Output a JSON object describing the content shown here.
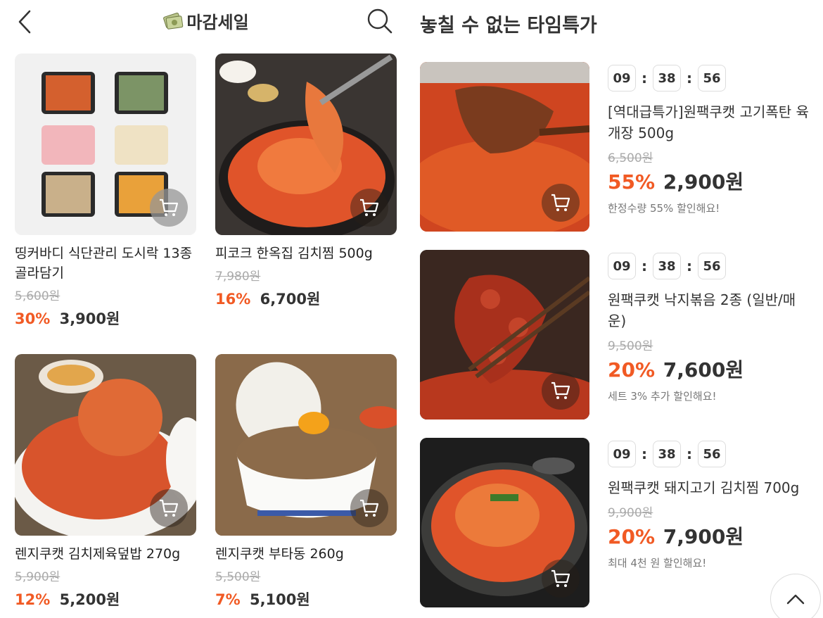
{
  "left": {
    "title": "마감세일",
    "products": [
      {
        "name": "띵커바디 식단관리 도시락 13종 골라담기",
        "original_price": "5,600원",
        "discount": "30%",
        "price": "3,900원"
      },
      {
        "name": "피코크 한옥집 김치찜 500g",
        "original_price": "7,980원",
        "discount": "16%",
        "price": "6,700원"
      },
      {
        "name": "렌지쿠캣 김치제육덮밥 270g",
        "original_price": "5,900원",
        "discount": "12%",
        "price": "5,200원"
      },
      {
        "name": "렌지쿠캣 부타동 260g",
        "original_price": "5,500원",
        "discount": "7%",
        "price": "5,100원"
      }
    ]
  },
  "right": {
    "title": "놓칠 수 없는 타임특가",
    "timer": {
      "hours": "09",
      "minutes": "38",
      "seconds": "56",
      "separator": ":"
    },
    "deals": [
      {
        "name": "[역대급특가]원팩쿠캣 고기폭탄 육개장 500g",
        "original_price": "6,500원",
        "discount": "55%",
        "price": "2,900원",
        "note": "한정수량 55% 할인해요!"
      },
      {
        "name": "원팩쿠캣 낙지볶음 2종 (일반/매운)",
        "original_price": "9,500원",
        "discount": "20%",
        "price": "7,600원",
        "note": "세트 3% 추가 할인해요!"
      },
      {
        "name": "원팩쿠캣 돼지고기 김치찜 700g",
        "original_price": "9,900원",
        "discount": "20%",
        "price": "7,900원",
        "note": "최대 4천 원 할인해요!"
      }
    ]
  },
  "colors": {
    "discount": "#f15a24",
    "text": "#333333",
    "muted": "#aaaaaa"
  },
  "icons": [
    "back-icon",
    "money-icon",
    "search-icon",
    "cart-icon",
    "chevron-up-icon"
  ]
}
